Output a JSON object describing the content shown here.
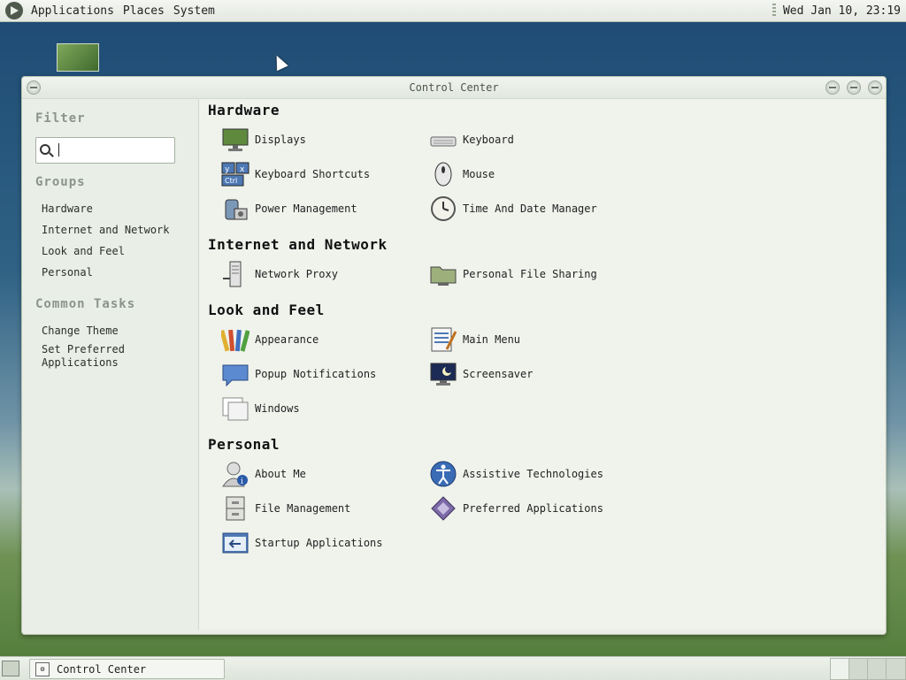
{
  "topbar": {
    "menus": [
      "Applications",
      "Places",
      "System"
    ],
    "clock": "Wed Jan 10, 23:19"
  },
  "window": {
    "title": "Control Center"
  },
  "sidebar": {
    "filter_heading": "Filter",
    "search_value": "",
    "groups_heading": "Groups",
    "groups": [
      "Hardware",
      "Internet and Network",
      "Look and Feel",
      "Personal"
    ],
    "common_heading": "Common Tasks",
    "tasks": [
      "Change Theme",
      "Set Preferred Applications"
    ]
  },
  "sections": [
    {
      "title": "Hardware",
      "items": [
        {
          "label": "Displays",
          "icon": "display-icon"
        },
        {
          "label": "Keyboard",
          "icon": "keyboard-icon"
        },
        {
          "label": "Keyboard Shortcuts",
          "icon": "keyboard-shortcuts-icon"
        },
        {
          "label": "Mouse",
          "icon": "mouse-icon"
        },
        {
          "label": "Power Management",
          "icon": "power-management-icon"
        },
        {
          "label": "Time And Date Manager",
          "icon": "clock-icon"
        }
      ]
    },
    {
      "title": "Internet and Network",
      "items": [
        {
          "label": "Network Proxy",
          "icon": "network-proxy-icon"
        },
        {
          "label": "Personal File Sharing",
          "icon": "folder-share-icon"
        }
      ]
    },
    {
      "title": "Look and Feel",
      "items": [
        {
          "label": "Appearance",
          "icon": "appearance-icon"
        },
        {
          "label": "Main Menu",
          "icon": "main-menu-icon"
        },
        {
          "label": "Popup Notifications",
          "icon": "notification-icon"
        },
        {
          "label": "Screensaver",
          "icon": "screensaver-icon"
        },
        {
          "label": "Windows",
          "icon": "windows-icon"
        }
      ]
    },
    {
      "title": "Personal",
      "items": [
        {
          "label": "About Me",
          "icon": "about-me-icon"
        },
        {
          "label": "Assistive Technologies",
          "icon": "accessibility-icon"
        },
        {
          "label": "File Management",
          "icon": "file-cabinet-icon"
        },
        {
          "label": "Preferred Applications",
          "icon": "preferred-apps-icon"
        },
        {
          "label": "Startup Applications",
          "icon": "startup-icon"
        }
      ]
    }
  ],
  "taskbar": {
    "task_label": "Control Center"
  }
}
